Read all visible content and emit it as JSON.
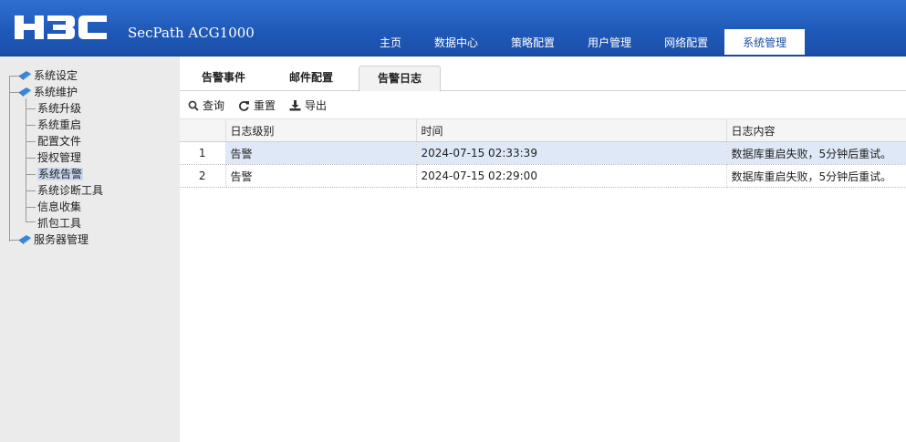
{
  "header": {
    "product": "SecPath ACG1000",
    "nav": [
      {
        "label": "主页",
        "active": false
      },
      {
        "label": "数据中心",
        "active": false
      },
      {
        "label": "策略配置",
        "active": false
      },
      {
        "label": "用户管理",
        "active": false
      },
      {
        "label": "网络配置",
        "active": false
      },
      {
        "label": "系统管理",
        "active": true
      }
    ]
  },
  "sidebar": {
    "items": [
      {
        "label": "系统设定",
        "level": 0,
        "icon": "book-icon"
      },
      {
        "label": "系统维护",
        "level": 0,
        "icon": "book-icon"
      },
      {
        "label": "系统升级",
        "level": 1
      },
      {
        "label": "系统重启",
        "level": 1
      },
      {
        "label": "配置文件",
        "level": 1
      },
      {
        "label": "授权管理",
        "level": 1
      },
      {
        "label": "系统告警",
        "level": 1,
        "selected": true
      },
      {
        "label": "系统诊断工具",
        "level": 1
      },
      {
        "label": "信息收集",
        "level": 1
      },
      {
        "label": "抓包工具",
        "level": 1
      },
      {
        "label": "服务器管理",
        "level": 0,
        "icon": "book-icon"
      }
    ]
  },
  "tabs": [
    {
      "label": "告警事件",
      "active": false
    },
    {
      "label": "邮件配置",
      "active": false
    },
    {
      "label": "告警日志",
      "active": true
    }
  ],
  "toolbar": {
    "query_label": "查询",
    "reset_label": "重置",
    "export_label": "导出",
    "icons": [
      "search-icon",
      "refresh-icon",
      "download-icon"
    ]
  },
  "table": {
    "columns": [
      "",
      "日志级别",
      "时间",
      "日志内容"
    ],
    "rows": [
      {
        "index": "1",
        "level": "告警",
        "time": "2024-07-15 02:33:39",
        "content": "数据库重启失败，5分钟后重试。",
        "selected": true
      },
      {
        "index": "2",
        "level": "告警",
        "time": "2024-07-15 02:29:00",
        "content": "数据库重启失败，5分钟后重试。",
        "selected": false
      }
    ]
  },
  "colors": {
    "header_blue": "#1f59b8",
    "sidebar_bg": "#ebebeb",
    "selected_row": "#dfe8f6"
  }
}
